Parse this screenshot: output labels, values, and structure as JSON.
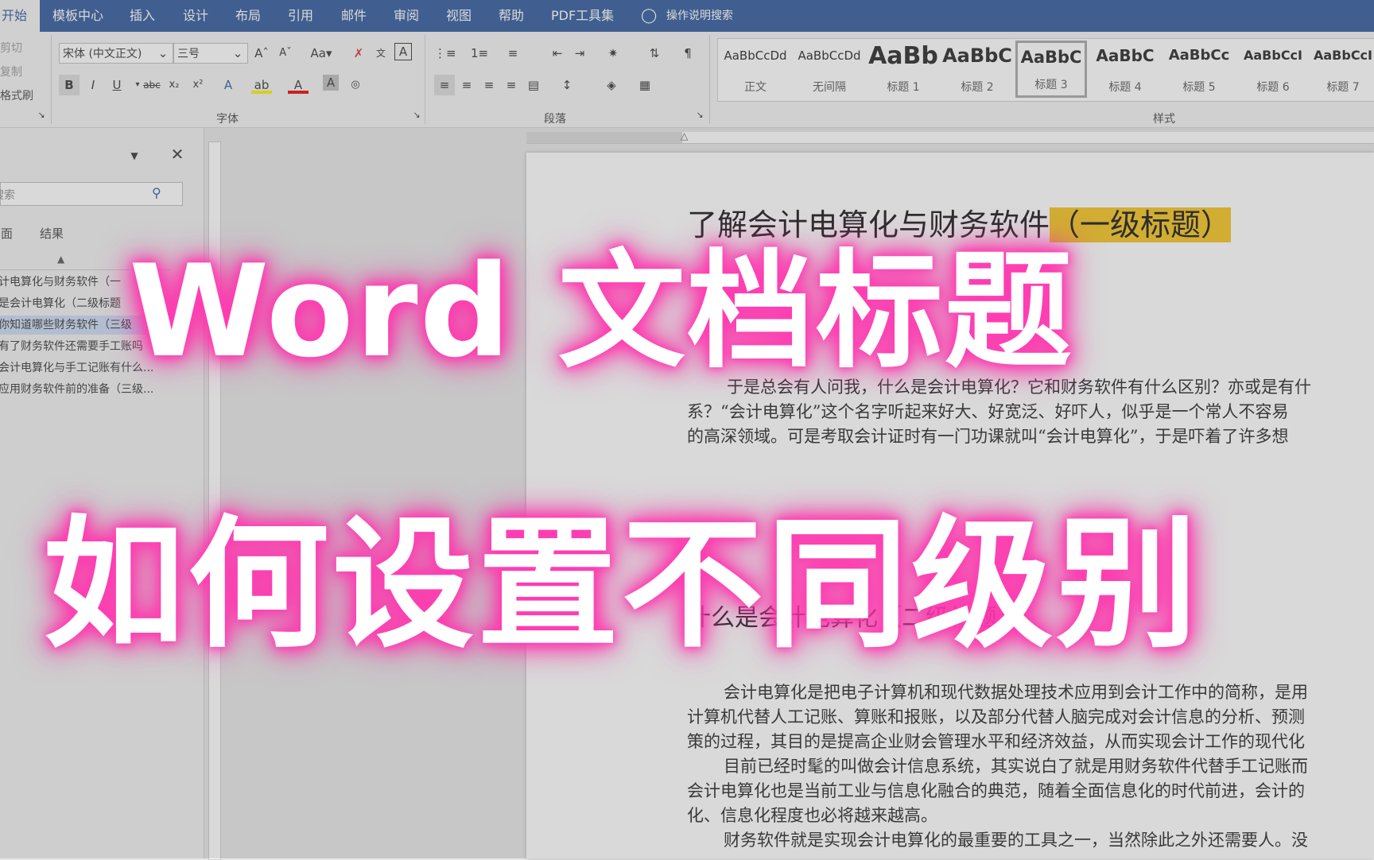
{
  "tabs": [
    "开始",
    "模板中心",
    "插入",
    "设计",
    "布局",
    "引用",
    "邮件",
    "审阅",
    "视图",
    "帮助",
    "PDF工具集"
  ],
  "tell_me": "操作说明搜索",
  "clipboard": {
    "cut": "剪切",
    "copy": "复制",
    "format_painter": "格式刷"
  },
  "font": {
    "name": "宋体 (中文正文)",
    "size": "三号",
    "group_label": "字体"
  },
  "paragraph": {
    "group_label": "段落"
  },
  "styles": {
    "group_label": "样式",
    "items": [
      {
        "preview": "AaBbCcDd",
        "label": "正文"
      },
      {
        "preview": "AaBbCcDd",
        "label": "无间隔"
      },
      {
        "preview": "AaBb",
        "label": "标题 1"
      },
      {
        "preview": "AaBbC",
        "label": "标题 2"
      },
      {
        "preview": "AaBbC",
        "label": "标题 3"
      },
      {
        "preview": "AaBbC",
        "label": "标题 4"
      },
      {
        "preview": "AaBbCc",
        "label": "标题 5"
      },
      {
        "preview": "AaBbCcI",
        "label": "标题 6"
      },
      {
        "preview": "AaBbCcI",
        "label": "标题 7"
      }
    ],
    "selected_index": 4
  },
  "nav": {
    "search_placeholder": "搜索",
    "tab_pages": "页面",
    "tab_results": "结果",
    "items": [
      "计电算化与财务软件（一",
      "是会计电算化（二级标题",
      "你知道哪些财务软件（三级",
      "有了财务软件还需要手工账吗",
      "会计电算化与手工记账有什么...",
      "应用财务软件前的准备（三级..."
    ],
    "selected_index": 2
  },
  "document": {
    "heading1_main": "了解会计电算化与财务软件",
    "heading1_tag": "（一级标题）",
    "p1_line1": "于是总会有人问我，什么是会计电算化？它和财务软件有什么区别？亦或是有什",
    "p1_line2": "系？“会计电算化”这个名字听起来好大、好宽泛、好吓人，似乎是一个常人不容易",
    "p1_line3": "的高深领域。可是考取会计证时有一门功课就叫“会计电算化”，于是吓着了许多想",
    "heading2": "什么是会计电算化（二级标题）",
    "p2_line1": "会计电算化是把电子计算机和现代数据处理技术应用到会计工作中的简称，是用",
    "p2_line2": "计算机代替人工记账、算账和报账，以及部分代替人脑完成对会计信息的分析、预测",
    "p2_line3": "策的过程，其目的是提高企业财会管理水平和经济效益，从而实现会计工作的现代化",
    "p3_line1": "目前已经时髦的叫做会计信息系统，其实说白了就是用财务软件代替手工记账而",
    "p3_line2": "会计电算化也是当前工业与信息化融合的典范，随着全面信息化的时代前进，会计的",
    "p3_line3": "化、信息化程度也必将越来越高。",
    "p4_line1": "财务软件就是实现会计电算化的最重要的工具之一，当然除此之外还需要人。没"
  },
  "overlay": {
    "line1": "Word 文档标题",
    "line2": "如何设置不同级别"
  }
}
